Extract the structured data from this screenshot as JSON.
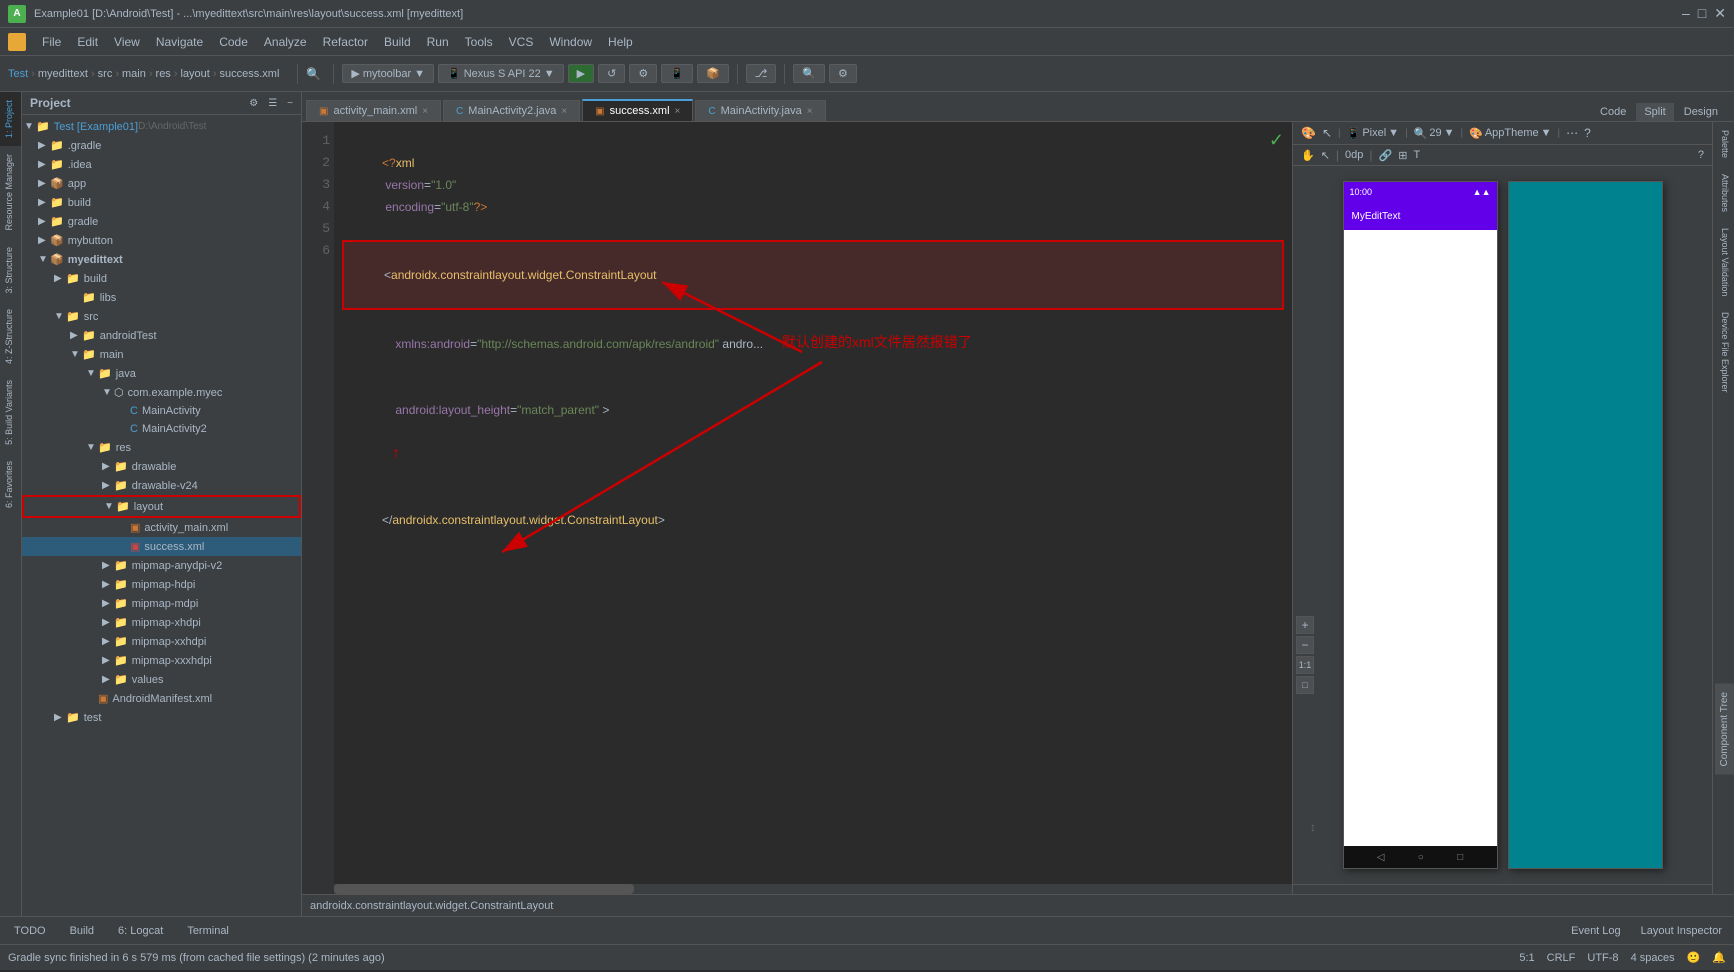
{
  "app": {
    "title": "Example01 [D:\\Android\\Test] - ...\\myedittext\\src\\main\\res\\layout\\success.xml [myedittext]",
    "window_controls": [
      "minimize",
      "maximize",
      "close"
    ]
  },
  "menubar": {
    "items": [
      "File",
      "Edit",
      "View",
      "Navigate",
      "Code",
      "Analyze",
      "Refactor",
      "Build",
      "Run",
      "Tools",
      "VCS",
      "Window",
      "Help"
    ],
    "app_icon": "A"
  },
  "toolbar": {
    "breadcrumb": [
      "Test",
      "myedittext",
      "src",
      "main",
      "res",
      "layout",
      "success.xml"
    ],
    "run_config": "mytoolbar",
    "device": "Nexus S API 22"
  },
  "tabs": [
    {
      "label": "activity_main.xml",
      "type": "xml",
      "active": false
    },
    {
      "label": "MainActivity2.java",
      "type": "java",
      "active": false
    },
    {
      "label": "success.xml",
      "type": "xml",
      "active": true
    },
    {
      "label": "MainActivity.java",
      "type": "java",
      "active": false
    }
  ],
  "editor": {
    "view_mode_buttons": [
      "Code",
      "Split",
      "Design"
    ],
    "lines": [
      {
        "num": 1,
        "content": "<?xml version=\"1.0\" encoding=\"utf-8\"?>"
      },
      {
        "num": 2,
        "content": "<androidx.constraintlayout.widget.ConstraintLayout"
      },
      {
        "num": 3,
        "content": "    xmlns:android=\"http://schemas.android.com/apk/res/android\" andro..."
      },
      {
        "num": 4,
        "content": "    android:layout_height=\"match_parent\" >"
      },
      {
        "num": 5,
        "content": ""
      },
      {
        "num": 6,
        "content": "</androidx.constraintlayout.widget.ConstraintLayout>"
      }
    ],
    "status_bar_text": "androidx.constraintlayout.widget.ConstraintLayout",
    "annotation_text": "默认创建的xml文件居然报错了",
    "cursor_position": "5:1",
    "encoding": "CRLF",
    "charset": "UTF-8",
    "indent": "4 spaces"
  },
  "project_tree": {
    "root": "Test [Example01]",
    "root_path": "D:\\Android\\Test",
    "items": [
      {
        "label": ".gradle",
        "type": "folder",
        "level": 1
      },
      {
        "label": ".idea",
        "type": "folder",
        "level": 1
      },
      {
        "label": "app",
        "type": "module",
        "level": 1,
        "expanded": false
      },
      {
        "label": "build",
        "type": "folder",
        "level": 1
      },
      {
        "label": "gradle",
        "type": "folder",
        "level": 1
      },
      {
        "label": "mybutton",
        "type": "module",
        "level": 1
      },
      {
        "label": "myedittext",
        "type": "module",
        "level": 1,
        "expanded": true
      },
      {
        "label": "build",
        "type": "folder",
        "level": 2
      },
      {
        "label": "libs",
        "type": "folder",
        "level": 3
      },
      {
        "label": "src",
        "type": "folder",
        "level": 2,
        "expanded": true
      },
      {
        "label": "androidTest",
        "type": "folder",
        "level": 3
      },
      {
        "label": "main",
        "type": "folder",
        "level": 3,
        "expanded": true
      },
      {
        "label": "java",
        "type": "folder",
        "level": 4,
        "expanded": true
      },
      {
        "label": "com.example.myec",
        "type": "package",
        "level": 5,
        "expanded": true
      },
      {
        "label": "MainActivity",
        "type": "java",
        "level": 6
      },
      {
        "label": "MainActivity2",
        "type": "java",
        "level": 6
      },
      {
        "label": "res",
        "type": "folder",
        "level": 4,
        "expanded": true
      },
      {
        "label": "drawable",
        "type": "folder",
        "level": 5
      },
      {
        "label": "drawable-v24",
        "type": "folder",
        "level": 5
      },
      {
        "label": "layout",
        "type": "folder",
        "level": 5,
        "expanded": true,
        "highlighted": true
      },
      {
        "label": "activity_main.xml",
        "type": "xml",
        "level": 6
      },
      {
        "label": "success.xml",
        "type": "xml-error",
        "level": 6,
        "selected": true
      },
      {
        "label": "mipmap-anydpi-v2",
        "type": "folder",
        "level": 5
      },
      {
        "label": "mipmap-hdpi",
        "type": "folder",
        "level": 5
      },
      {
        "label": "mipmap-mdpi",
        "type": "folder",
        "level": 5
      },
      {
        "label": "mipmap-xhdpi",
        "type": "folder",
        "level": 5
      },
      {
        "label": "mipmap-xxhdpi",
        "type": "folder",
        "level": 5
      },
      {
        "label": "mipmap-xxxhdpi",
        "type": "folder",
        "level": 5
      },
      {
        "label": "values",
        "type": "folder",
        "level": 5
      },
      {
        "label": "AndroidManifest.xml",
        "type": "xml",
        "level": 4
      },
      {
        "label": "test",
        "type": "folder",
        "level": 2
      }
    ]
  },
  "design_panel": {
    "toolbar": {
      "pixel": "Pixel",
      "zoom": "29",
      "theme": "AppTheme"
    },
    "phone1": {
      "time": "10:00",
      "app_name": "MyEditText",
      "has_content": true
    },
    "phone2": {
      "color": "#00838f",
      "has_content": true
    }
  },
  "side_panels": {
    "left_tabs": [
      "1:Project",
      "2:Resource Manager",
      "3:Structure",
      "4:Z-Structure",
      "5:Build Variants",
      "6:Favorites"
    ],
    "right_tabs": [
      "Palette",
      "Attributes",
      "Layout Validation",
      "Device File Explorer"
    ]
  },
  "bottom_bar": {
    "tabs": [
      "TODO",
      "Build",
      "6: Logcat",
      "Terminal"
    ],
    "status": "Gradle sync finished in 6 s 579 ms (from cached file settings) (2 minutes ago)",
    "right_items": [
      "Event Log",
      "Layout Inspector"
    ]
  },
  "statusbar": {
    "cursor": "5:1",
    "line_ending": "CRLF",
    "encoding": "UTF-8",
    "indent": "4 spaces"
  }
}
